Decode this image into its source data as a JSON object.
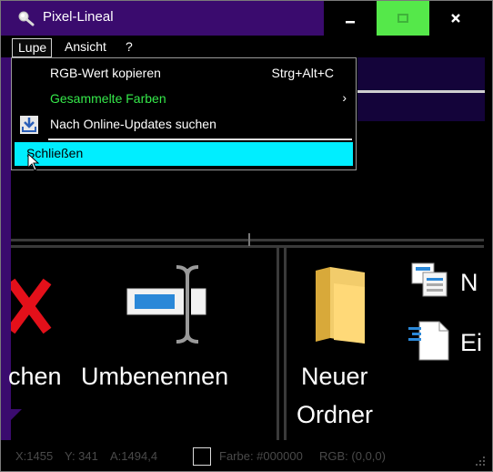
{
  "window": {
    "title": "Pixel-Lineal"
  },
  "title_controls": {
    "minimize": "—",
    "maximize": "□",
    "close": "✕",
    "maximize_color": "#55e84a"
  },
  "menubar": {
    "lupe": "Lupe",
    "ansicht": "Ansicht",
    "help": "?"
  },
  "dropdown": {
    "items": [
      {
        "label": "RGB-Wert kopieren",
        "shortcut": "Strg+Alt+C"
      },
      {
        "label": "Gesammelte Farben",
        "submenu_arrow": "›",
        "color": "#35e84a"
      },
      {
        "label": "Nach Online-Updates suchen",
        "icon": "download-icon"
      },
      {
        "label": "Schließen",
        "highlight_color": "#00eeff"
      }
    ]
  },
  "magnified_content": {
    "labels": {
      "chen": "chen",
      "umbenennen": "Umbenennen",
      "neuer": "Neuer",
      "ordner": "Ordner",
      "n": "N",
      "ei": "Ei"
    },
    "icons": [
      "delete-x-icon",
      "rename-icon",
      "folder-icon",
      "copy-path-icon",
      "new-item-icon"
    ]
  },
  "statusbar": {
    "x": "X:1455",
    "y": "Y: 341",
    "a": "A:1494,4",
    "farbe": "Farbe: #000000",
    "rgb": "RGB: (0,0,0)",
    "swatch_color": "#000000"
  }
}
